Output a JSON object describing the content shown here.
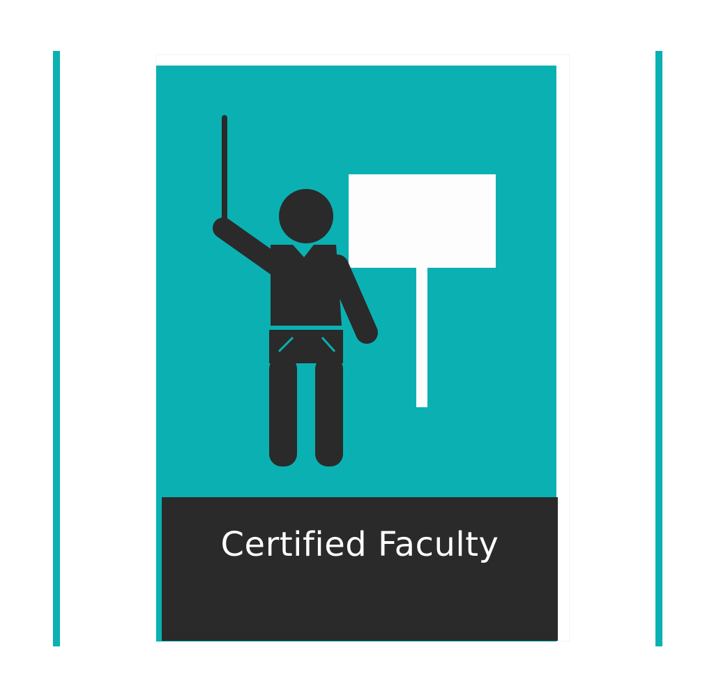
{
  "badge": {
    "caption": "Certified Faculty",
    "icon": "teacher-presenting-board-icon"
  },
  "colors": {
    "accent": "#0bb1b2",
    "dark": "#2a2a2a",
    "board": "#fdfdfd",
    "background": "#ffffff"
  }
}
